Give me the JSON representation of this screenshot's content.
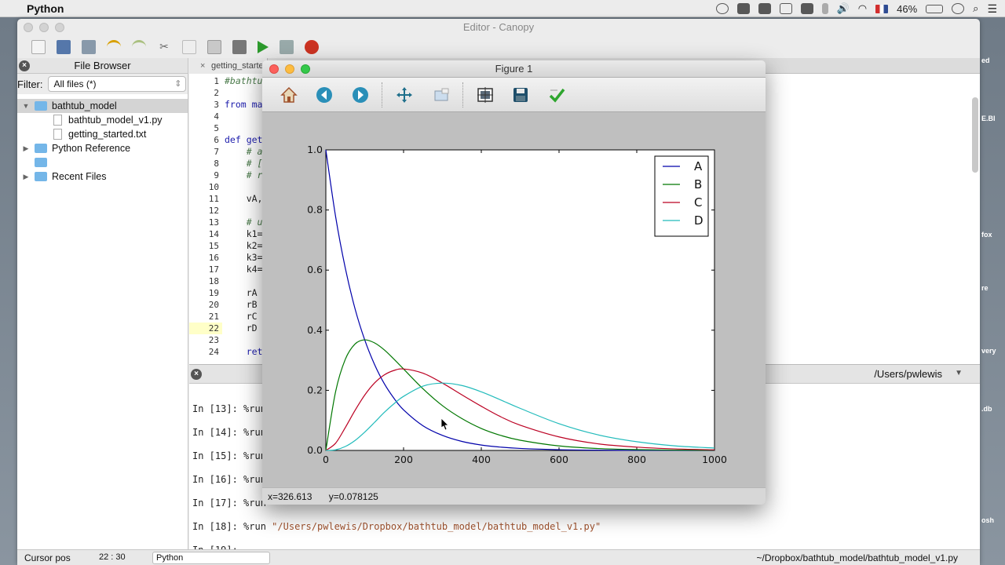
{
  "menubar": {
    "app_name": "Python"
  },
  "status_icons": {
    "language_flag": "uk-flag-icon",
    "battery": "46%"
  },
  "editor": {
    "title": "Editor - Canopy",
    "file_browser": {
      "title": "File Browser",
      "filter_label": "Filter:",
      "filter_value": "All files (*)",
      "tree": [
        {
          "label": "bathtub_model",
          "type": "folder",
          "expanded": true
        },
        {
          "label": "bathtub_model_v1.py",
          "type": "file"
        },
        {
          "label": "getting_started.txt",
          "type": "file"
        },
        {
          "label": "Python Reference",
          "type": "folder",
          "expanded": false
        },
        {
          "label": "",
          "type": "folder"
        },
        {
          "label": "Recent Files",
          "type": "folder",
          "expanded": false
        }
      ]
    },
    "tab_label": "getting_starte",
    "code": {
      "line_numbers": [
        "1",
        "2",
        "3",
        "4",
        "5",
        "6",
        "7",
        "8",
        "9",
        "10",
        "11",
        "12",
        "13",
        "14",
        "15",
        "16",
        "17",
        "18",
        "19",
        "20",
        "21",
        "22",
        "23",
        "24"
      ],
      "highlight_line": "22",
      "lines": [
        "#bathtu",
        "",
        "from ma",
        "",
        "",
        "def get",
        "    # a",
        "    # [",
        "    # r",
        "",
        "    vA,",
        "",
        "    # u",
        "    k1=",
        "    k2=",
        "    k3=",
        "    k4=",
        "",
        "    rA",
        "    rB",
        "    rC",
        "    rD",
        "",
        "    ret"
      ]
    },
    "console": {
      "cwd": "/Users/pwlewis",
      "entries": [
        {
          "prompt": "In [13]:",
          "cmd": "%run"
        },
        {
          "prompt": "In [14]:",
          "cmd": "%run"
        },
        {
          "prompt": "In [15]:",
          "cmd": "%run"
        },
        {
          "prompt": "In [16]:",
          "cmd": "%run"
        },
        {
          "prompt": "In [17]:",
          "cmd": "%run"
        },
        {
          "prompt": "In [18]:",
          "cmd": "%run",
          "arg": "\"/Users/pwlewis/Dropbox/bathtub_model/bathtub_model_v1.py\""
        },
        {
          "prompt": "In [19]:",
          "cmd": ""
        }
      ]
    },
    "status": {
      "cursor_label": "Cursor pos",
      "cursor_value": "22 : 30",
      "language": "Python",
      "file_path": "~/Dropbox/bathtub_model/bathtub_model_v1.py"
    }
  },
  "figure": {
    "title": "Figure 1",
    "toolbar": [
      "home-icon",
      "back-arrow-icon",
      "forward-arrow-icon",
      "pan-icon",
      "zoom-icon",
      "subplots-icon",
      "save-icon",
      "edit-check-icon"
    ],
    "coords": {
      "x": "x=326.613",
      "y": "y=0.078125"
    }
  },
  "chart_data": {
    "type": "line",
    "title": "",
    "xlabel": "",
    "ylabel": "",
    "xlim": [
      0,
      1000
    ],
    "ylim": [
      0,
      1.0
    ],
    "xticks": [
      "0",
      "200",
      "400",
      "600",
      "800",
      "1000"
    ],
    "yticks": [
      "0.0",
      "0.2",
      "0.4",
      "0.6",
      "0.8",
      "1.0"
    ],
    "legend_position": "top-right",
    "grid": false,
    "x": [
      0,
      25,
      50,
      75,
      100,
      125,
      150,
      175,
      200,
      250,
      300,
      350,
      400,
      450,
      500,
      600,
      700,
      800,
      900,
      1000
    ],
    "series": [
      {
        "name": "A",
        "color": "#0000aa",
        "values": [
          1.0,
          0.779,
          0.607,
          0.472,
          0.368,
          0.287,
          0.223,
          0.174,
          0.135,
          0.082,
          0.05,
          0.03,
          0.018,
          0.011,
          0.0067,
          0.0025,
          0.0009,
          0.0003,
          0.0001,
          0.0
        ]
      },
      {
        "name": "B",
        "color": "#007700",
        "values": [
          0.0,
          0.195,
          0.303,
          0.354,
          0.368,
          0.358,
          0.335,
          0.304,
          0.271,
          0.205,
          0.149,
          0.106,
          0.073,
          0.05,
          0.034,
          0.015,
          0.0064,
          0.0027,
          0.0011,
          0.0005
        ]
      },
      {
        "name": "C",
        "color": "#bb0022",
        "values": [
          0.0,
          0.024,
          0.076,
          0.133,
          0.184,
          0.224,
          0.251,
          0.266,
          0.271,
          0.257,
          0.224,
          0.185,
          0.147,
          0.112,
          0.084,
          0.045,
          0.022,
          0.011,
          0.005,
          0.002
        ]
      },
      {
        "name": "D",
        "color": "#22bbbb",
        "values": [
          0.0,
          0.002,
          0.013,
          0.033,
          0.061,
          0.093,
          0.126,
          0.155,
          0.18,
          0.214,
          0.224,
          0.216,
          0.195,
          0.168,
          0.14,
          0.089,
          0.052,
          0.029,
          0.015,
          0.008
        ]
      }
    ]
  }
}
